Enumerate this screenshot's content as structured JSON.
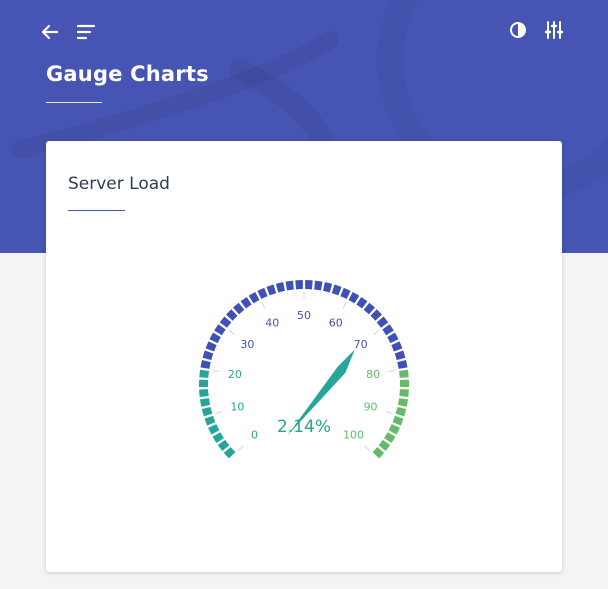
{
  "header": {
    "title": "Gauge Charts",
    "icons": [
      "back-arrow-icon",
      "menu-lines-icon",
      "contrast-icon",
      "sliders-icon"
    ]
  },
  "card": {
    "title": "Server Load"
  },
  "colors": {
    "hero": "#4655b3",
    "blue_band": "#3f51b5",
    "teal_band": "#26a69a",
    "green_band": "#66bb6a",
    "needle": "#26a69a"
  },
  "chart_data": {
    "type": "gauge",
    "value": 2.14,
    "value_label": "2.14%",
    "min": 0,
    "max": 100,
    "ticks": [
      0,
      10,
      20,
      30,
      40,
      50,
      60,
      70,
      80,
      90,
      100
    ],
    "bands": [
      {
        "from": 0,
        "to": 20,
        "color": "#26a69a"
      },
      {
        "from": 20,
        "to": 80,
        "color": "#3f51b5"
      },
      {
        "from": 80,
        "to": 100,
        "color": "#66bb6a"
      }
    ]
  }
}
